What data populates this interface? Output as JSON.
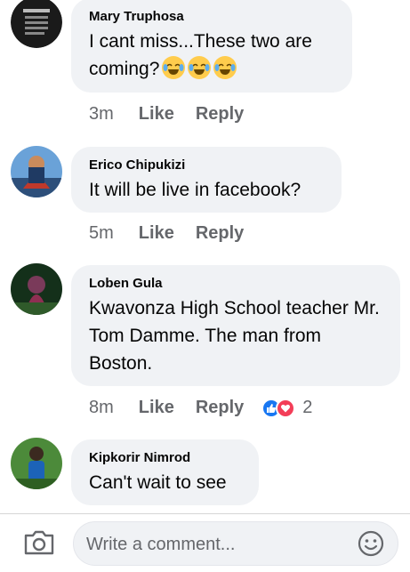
{
  "comments": [
    {
      "author": "Mary Truphosa",
      "text": "I cant miss...These two are coming?",
      "emoji": [
        "laughing-crying-emoji",
        "laughing-crying-emoji",
        "laughing-crying-emoji"
      ],
      "time": "3m",
      "like_label": "Like",
      "reply_label": "Reply"
    },
    {
      "author": "Erico Chipukizi",
      "text": "It will be live in facebook?",
      "time": "5m",
      "like_label": "Like",
      "reply_label": "Reply"
    },
    {
      "author": "Loben Gula",
      "text": "Kwavonza High School teacher Mr. Tom Damme. The man from Boston.",
      "time": "8m",
      "like_label": "Like",
      "reply_label": "Reply",
      "reaction_count": "2"
    },
    {
      "author": "Kipkorir Nimrod",
      "text": "Can't wait to see"
    }
  ],
  "composer": {
    "placeholder": "Write a comment..."
  },
  "colors": {
    "bubble": "#f0f2f5",
    "meta": "#65676b",
    "like_reaction": "#1877f2",
    "love_reaction": "#f33e58"
  }
}
